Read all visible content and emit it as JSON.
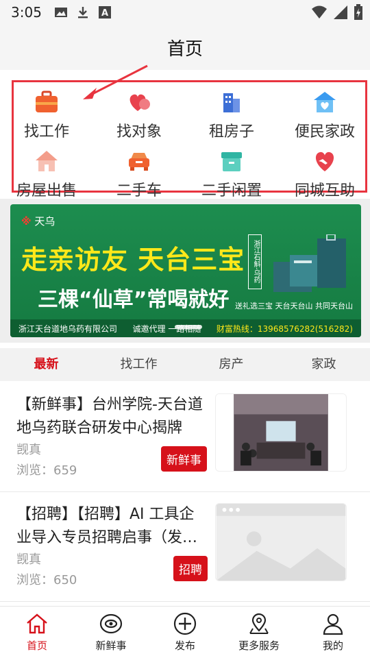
{
  "status_bar": {
    "time": "3:05",
    "icons": [
      "image-icon",
      "download-icon",
      "a-icon",
      "wifi-icon",
      "signal-icon",
      "battery-icon"
    ]
  },
  "header": {
    "title": "首页"
  },
  "categories": [
    {
      "label": "找工作",
      "icon": "briefcase-icon",
      "color": "#f0612f"
    },
    {
      "label": "找对象",
      "icon": "hearts-icon",
      "color": "#e8424d"
    },
    {
      "label": "租房子",
      "icon": "building-icon",
      "color": "#3d6fd6"
    },
    {
      "label": "便民家政",
      "icon": "house-heart-icon",
      "color": "#3a9bf0"
    },
    {
      "label": "房屋出售",
      "icon": "house-icon",
      "color": "#f39d8a"
    },
    {
      "label": "二手车",
      "icon": "car-icon",
      "color": "#f0612f"
    },
    {
      "label": "二手闲置",
      "icon": "box-icon",
      "color": "#2fb5a3"
    },
    {
      "label": "同城互助",
      "icon": "handshake-icon",
      "color": "#e8424d"
    }
  ],
  "banner": {
    "brand": "天乌",
    "headline": "走亲访友 天台三宝",
    "slogan": "三棵“仙草”常喝就好",
    "vertical_text": "浙江石斛·乌药",
    "note": "送礼选三宝 天台天台山 共同天台山",
    "company": "浙江天台道地乌药有限公司",
    "agent": "诚邀代理 一路相随",
    "hotline_label": "财富热线：",
    "hotline": "13968576282(516282)"
  },
  "tabs": [
    {
      "label": "最新",
      "active": true
    },
    {
      "label": "找工作",
      "active": false
    },
    {
      "label": "房产",
      "active": false
    },
    {
      "label": "家政",
      "active": false
    }
  ],
  "articles": [
    {
      "title": "【新鲜事】台州学院-天台道地乌药联合研发中心揭牌",
      "author": "觊真",
      "views": "浏览：659",
      "badge": "新鲜事"
    },
    {
      "title": "【招聘】【招聘】AI 工具企业导入专员招聘启事（发…",
      "author": "觊真",
      "views": "浏览：650",
      "badge": "招聘"
    }
  ],
  "bottom_nav": [
    {
      "label": "首页",
      "icon": "home-icon",
      "active": true
    },
    {
      "label": "新鲜事",
      "icon": "eye-icon",
      "active": false
    },
    {
      "label": "发布",
      "icon": "plus-circle-icon",
      "active": false
    },
    {
      "label": "更多服务",
      "icon": "location-icon",
      "active": false
    },
    {
      "label": "我的",
      "icon": "user-icon",
      "active": false
    }
  ],
  "colors": {
    "accent": "#d6111a",
    "annotation": "#e8343f",
    "banner_green": "#1d8d4f"
  }
}
